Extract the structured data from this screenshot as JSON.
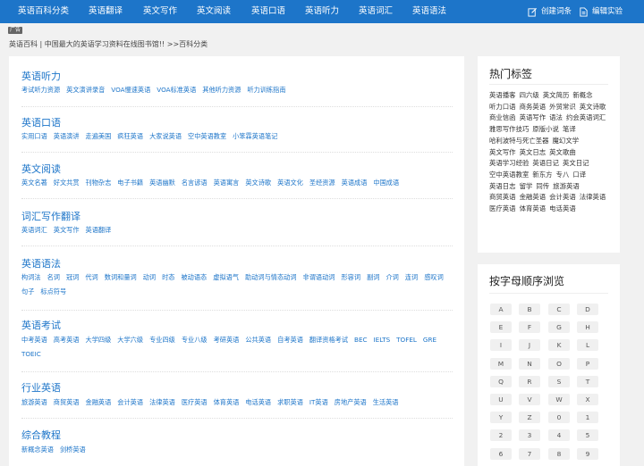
{
  "nav": {
    "items": [
      "英语百科分类",
      "英语翻译",
      "英文写作",
      "英文阅读",
      "英语口语",
      "英语听力",
      "英语词汇",
      "英语语法"
    ],
    "create_entry": "创建词条",
    "edit_experiment": "编辑实验"
  },
  "ad_tag": "广告",
  "breadcrumb": "英语百科 | 中国最大的英语学习资料在线图书馆!! >>百科分类",
  "sections": [
    {
      "title": "英语听力",
      "links": [
        "考试听力资源",
        "英文演讲录音",
        "VOA慢速英语",
        "VOA标准英语",
        "其他听力资源",
        "听力训练指南"
      ]
    },
    {
      "title": "英语口语",
      "links": [
        "实用口语",
        "英语演讲",
        "走遍美国",
        "疯狂英语",
        "大家说英语",
        "空中英语教室",
        "小笨霖英语笔记"
      ]
    },
    {
      "title": "英文阅读",
      "links": [
        "英文名著",
        "好文共赏",
        "刊物杂志",
        "电子书籍",
        "英语幽默",
        "名言谚语",
        "英语寓言",
        "英文诗歌",
        "英语文化",
        "圣经资源",
        "英语成语",
        "中国成语"
      ]
    },
    {
      "title": "词汇写作翻译",
      "links": [
        "英语词汇",
        "英文写作",
        "英语翻译"
      ]
    },
    {
      "title": "英语语法",
      "links": [
        "构词法",
        "名词",
        "冠词",
        "代词",
        "数词和量词",
        "动词",
        "时态",
        "被动语态",
        "虚拟语气",
        "助动词与情态动词",
        "非谓语动词",
        "形容词",
        "副词",
        "介词",
        "连词",
        "感叹词",
        "句子",
        "标点符号"
      ]
    },
    {
      "title": "英语考试",
      "links": [
        "中考英语",
        "高考英语",
        "大学四级",
        "大学六级",
        "专业四级",
        "专业八级",
        "考研英语",
        "公共英语",
        "自考英语",
        "翻译资格考试",
        "BEC",
        "IELTS",
        "TOFEL",
        "GRE",
        "TOEIC"
      ]
    },
    {
      "title": "行业英语",
      "links": [
        "旅游英语",
        "商贸英语",
        "金融英语",
        "会计英语",
        "法律英语",
        "医疗英语",
        "体育英语",
        "电话英语",
        "求职英语",
        "IT英语",
        "房地产英语",
        "生活英语"
      ]
    },
    {
      "title": "综合教程",
      "links": [
        "新概念英语",
        "剑桥英语"
      ]
    }
  ],
  "hot_tags": {
    "title": "热门标签",
    "tags": [
      "英语播客",
      "四六级",
      "英文简历",
      "新概念",
      "听力口语",
      "商务英语",
      "外贸常识",
      "英文诗歌",
      "商业信函",
      "英语写作",
      "语法",
      "约会英语词汇",
      "雅思写作技巧",
      "原版小说",
      "笔译",
      "哈利波特与死亡圣器",
      "魔幻文学",
      "英文写作",
      "英文日志",
      "英文歌曲",
      "英语学习经验",
      "英语日记",
      "英文日记",
      "空中英语教室",
      "新东方",
      "专八",
      "口译",
      "英语日志",
      "留学",
      "同传",
      "旅游英语",
      "商贸英语",
      "金融英语",
      "会计英语",
      "法律英语",
      "医疗英语",
      "体育英语",
      "电话英语"
    ]
  },
  "alpha": {
    "title": "按字母顺序浏览",
    "letters": [
      "A",
      "B",
      "C",
      "D",
      "E",
      "F",
      "G",
      "H",
      "I",
      "J",
      "K",
      "L",
      "M",
      "N",
      "O",
      "P",
      "Q",
      "R",
      "S",
      "T",
      "U",
      "V",
      "W",
      "X",
      "Y",
      "Z",
      "0",
      "1",
      "2",
      "3",
      "4",
      "5",
      "6",
      "7",
      "8",
      "9"
    ]
  }
}
